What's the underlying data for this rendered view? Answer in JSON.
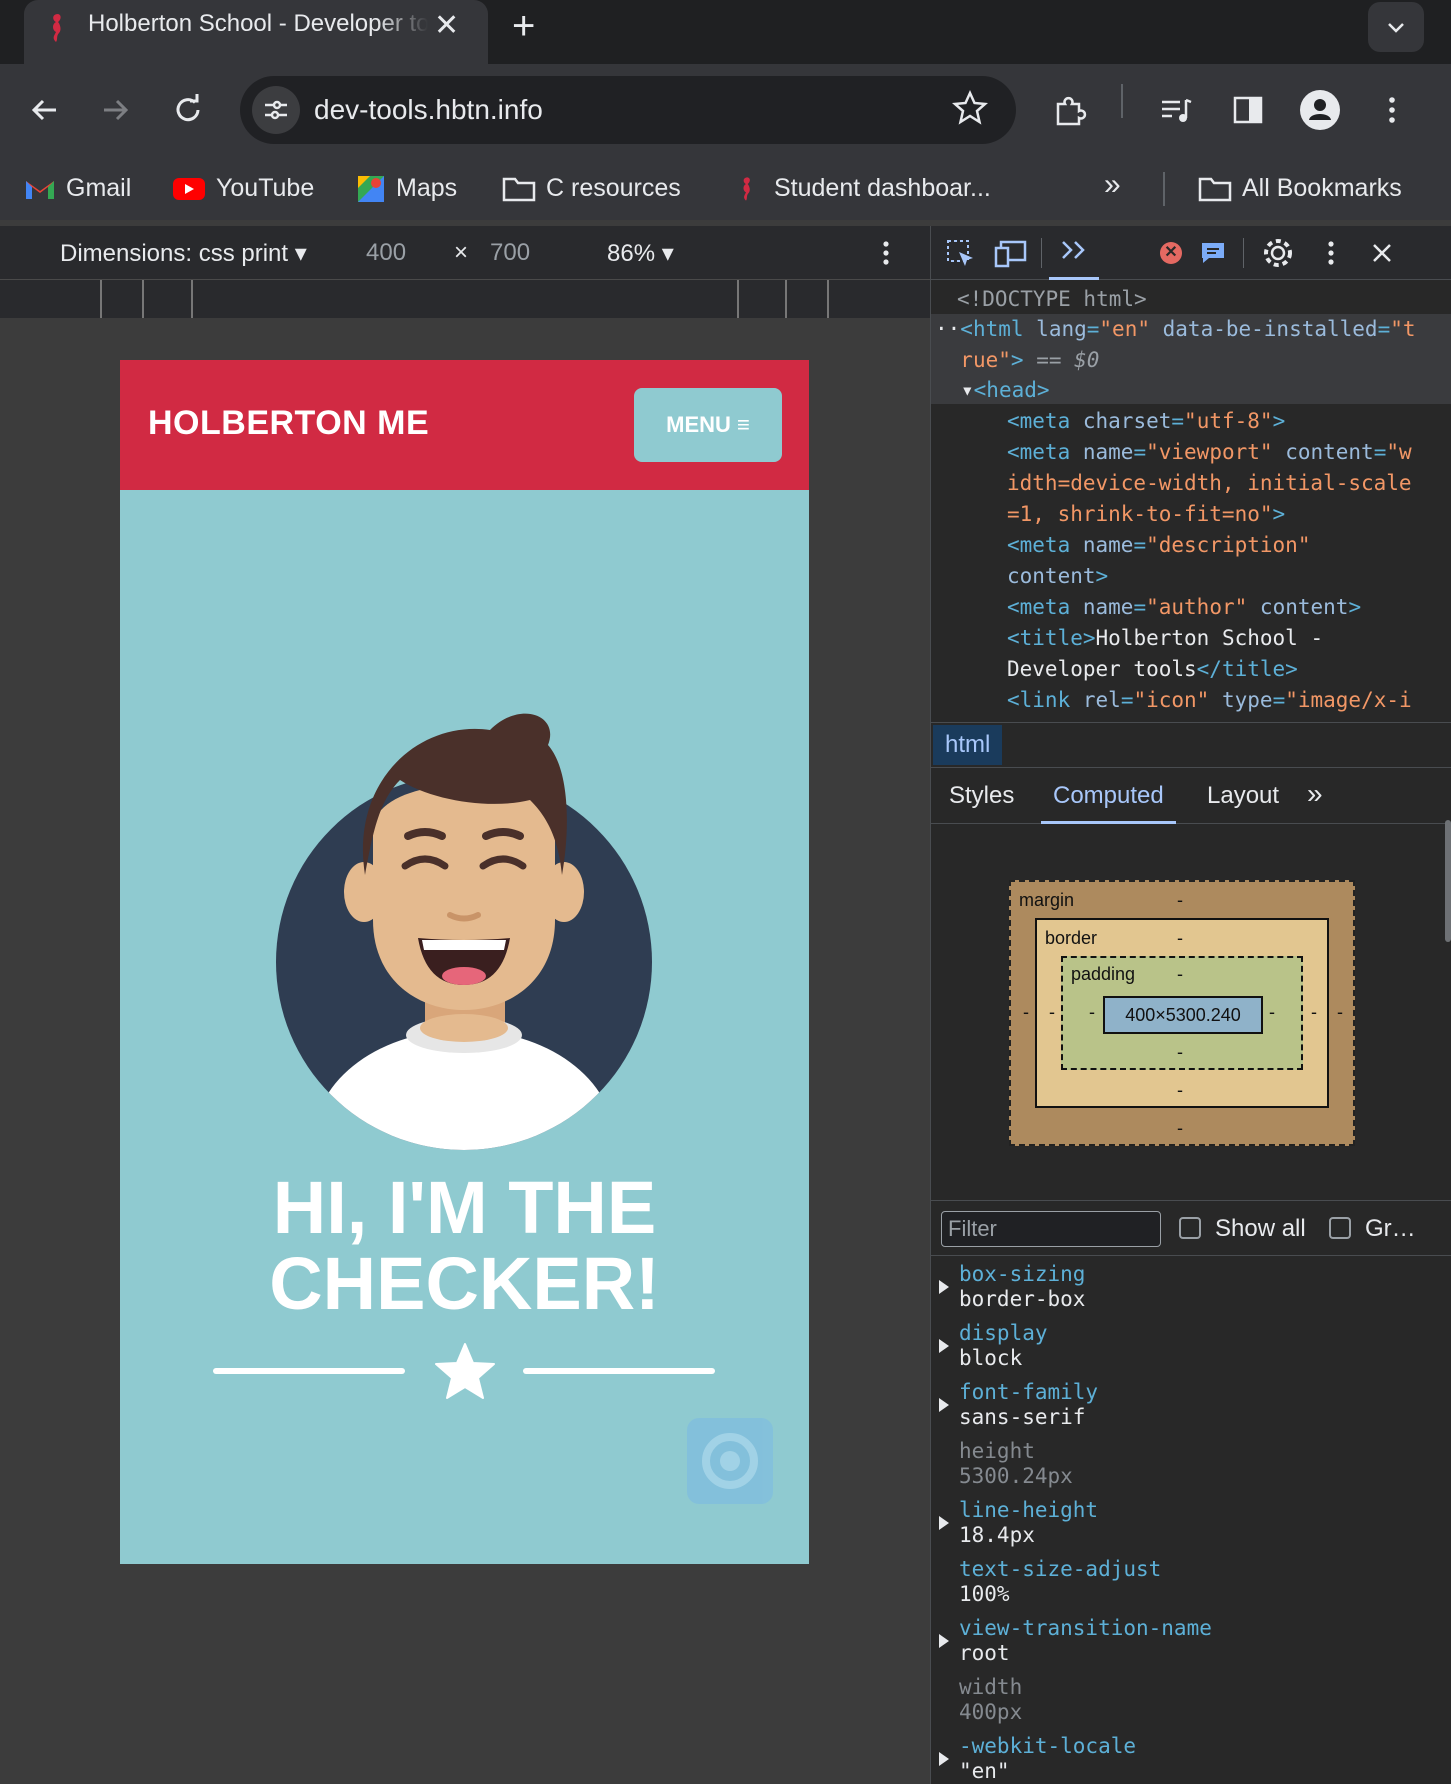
{
  "browser": {
    "tab_title": "Holberton School - Developer tools",
    "tab_close": "✕",
    "new_tab": "+",
    "url": "dev-tools.hbtn.info",
    "bookmarks": [
      {
        "label": "Gmail"
      },
      {
        "label": "YouTube"
      },
      {
        "label": "Maps"
      },
      {
        "label": "C resources"
      },
      {
        "label": "Student dashboar..."
      },
      {
        "label": "All Bookmarks"
      }
    ],
    "more_bookmarks": "»"
  },
  "device_toolbar": {
    "dimensions_label": "Dimensions: css print",
    "width": "400",
    "height": "700",
    "times": "×",
    "zoom": "86%"
  },
  "site": {
    "logo": "HOLBERTON ME",
    "menu_label": "MENU ≡",
    "hero_line1": "HI, I'M THE",
    "hero_line2": "CHECKER!"
  },
  "devtools": {
    "crumb": "html",
    "tabs": {
      "styles": "Styles",
      "computed": "Computed",
      "layout": "Layout",
      "more": "»"
    },
    "box_model": {
      "margin_label": "margin",
      "border_label": "border",
      "padding_label": "padding",
      "content_size": "400×5300.240",
      "dash": "-"
    },
    "filter_placeholder": "Filter",
    "show_all": "Show all",
    "group": "Gr…",
    "properties": [
      {
        "name": "box-sizing",
        "value": "border-box",
        "inherited": false
      },
      {
        "name": "display",
        "value": "block",
        "inherited": false
      },
      {
        "name": "font-family",
        "value": "sans-serif",
        "inherited": false
      },
      {
        "name": "height",
        "value": "5300.24px",
        "inherited": true
      },
      {
        "name": "line-height",
        "value": "18.4px",
        "inherited": false
      },
      {
        "name": "text-size-adjust",
        "value": "100%",
        "inherited": false
      },
      {
        "name": "view-transition-name",
        "value": "root",
        "inherited": false
      },
      {
        "name": "width",
        "value": "400px",
        "inherited": true
      },
      {
        "name": "-webkit-locale",
        "value": "\"en\"",
        "inherited": false
      }
    ]
  },
  "colors": {
    "header_red": "#d12a43",
    "site_teal": "#8fcad0",
    "avatar_navy": "#2f3d52"
  }
}
